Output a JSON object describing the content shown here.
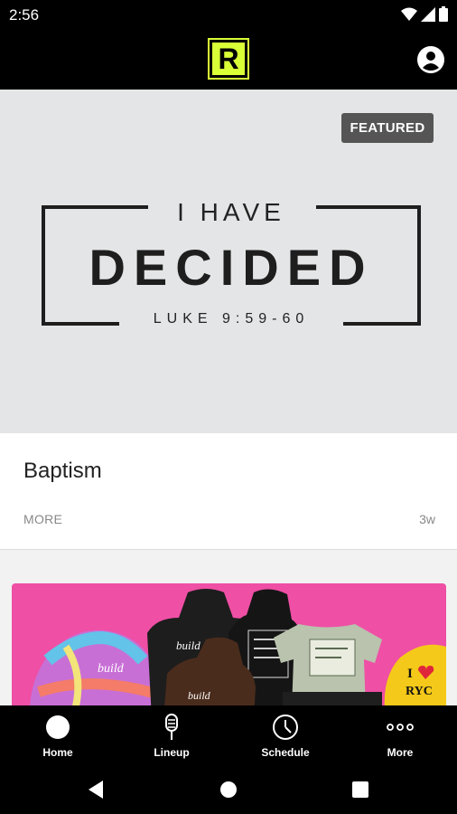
{
  "status_bar": {
    "time": "2:56",
    "icons": [
      "wifi-icon",
      "signal-icon",
      "battery-icon"
    ]
  },
  "app_bar": {
    "logo_text": "R",
    "logo_color": "#d9ff37",
    "profile_icon": "account-circle-icon"
  },
  "featured": {
    "badge": "FEATURED",
    "artwork": {
      "line1": "I HAVE",
      "line2": "DECIDED",
      "line3": "LUKE 9:59-60"
    }
  },
  "card": {
    "title": "Baptism",
    "more_label": "MORE",
    "age": "3w"
  },
  "promo": {
    "accent_color": "#ef4fa5",
    "items": [
      "bucket hat",
      "hoodie",
      "hoodie",
      "t-shirt",
      "I love RYC cap"
    ],
    "cap_text": "RYC"
  },
  "bottom_nav": {
    "items": [
      {
        "label": "Home",
        "icon": "home-circle-icon"
      },
      {
        "label": "Lineup",
        "icon": "microphone-icon"
      },
      {
        "label": "Schedule",
        "icon": "clock-icon"
      },
      {
        "label": "More",
        "icon": "more-dots-icon"
      }
    ]
  },
  "system_nav": {
    "icons": [
      "back-icon",
      "home-icon",
      "recents-icon"
    ]
  }
}
